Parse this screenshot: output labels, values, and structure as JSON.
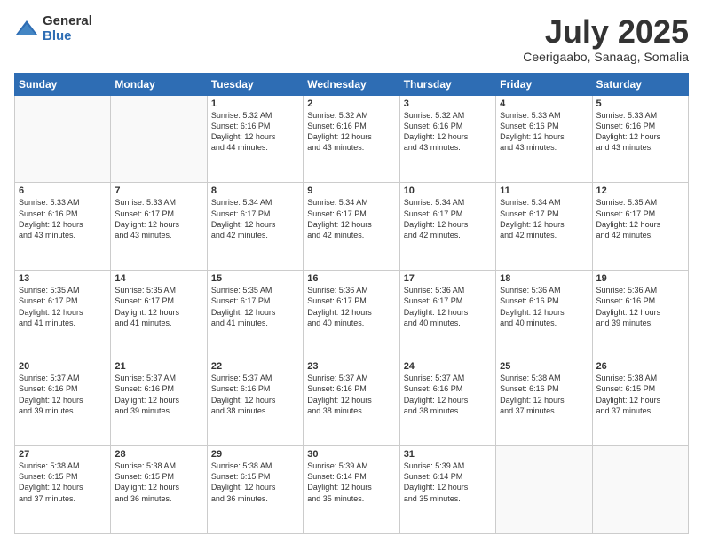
{
  "header": {
    "logo_general": "General",
    "logo_blue": "Blue",
    "month_title": "July 2025",
    "subtitle": "Ceerigaabo, Sanaag, Somalia"
  },
  "days_of_week": [
    "Sunday",
    "Monday",
    "Tuesday",
    "Wednesday",
    "Thursday",
    "Friday",
    "Saturday"
  ],
  "weeks": [
    [
      {
        "day": "",
        "info": ""
      },
      {
        "day": "",
        "info": ""
      },
      {
        "day": "1",
        "info": "Sunrise: 5:32 AM\nSunset: 6:16 PM\nDaylight: 12 hours\nand 44 minutes."
      },
      {
        "day": "2",
        "info": "Sunrise: 5:32 AM\nSunset: 6:16 PM\nDaylight: 12 hours\nand 43 minutes."
      },
      {
        "day": "3",
        "info": "Sunrise: 5:32 AM\nSunset: 6:16 PM\nDaylight: 12 hours\nand 43 minutes."
      },
      {
        "day": "4",
        "info": "Sunrise: 5:33 AM\nSunset: 6:16 PM\nDaylight: 12 hours\nand 43 minutes."
      },
      {
        "day": "5",
        "info": "Sunrise: 5:33 AM\nSunset: 6:16 PM\nDaylight: 12 hours\nand 43 minutes."
      }
    ],
    [
      {
        "day": "6",
        "info": "Sunrise: 5:33 AM\nSunset: 6:16 PM\nDaylight: 12 hours\nand 43 minutes."
      },
      {
        "day": "7",
        "info": "Sunrise: 5:33 AM\nSunset: 6:17 PM\nDaylight: 12 hours\nand 43 minutes."
      },
      {
        "day": "8",
        "info": "Sunrise: 5:34 AM\nSunset: 6:17 PM\nDaylight: 12 hours\nand 42 minutes."
      },
      {
        "day": "9",
        "info": "Sunrise: 5:34 AM\nSunset: 6:17 PM\nDaylight: 12 hours\nand 42 minutes."
      },
      {
        "day": "10",
        "info": "Sunrise: 5:34 AM\nSunset: 6:17 PM\nDaylight: 12 hours\nand 42 minutes."
      },
      {
        "day": "11",
        "info": "Sunrise: 5:34 AM\nSunset: 6:17 PM\nDaylight: 12 hours\nand 42 minutes."
      },
      {
        "day": "12",
        "info": "Sunrise: 5:35 AM\nSunset: 6:17 PM\nDaylight: 12 hours\nand 42 minutes."
      }
    ],
    [
      {
        "day": "13",
        "info": "Sunrise: 5:35 AM\nSunset: 6:17 PM\nDaylight: 12 hours\nand 41 minutes."
      },
      {
        "day": "14",
        "info": "Sunrise: 5:35 AM\nSunset: 6:17 PM\nDaylight: 12 hours\nand 41 minutes."
      },
      {
        "day": "15",
        "info": "Sunrise: 5:35 AM\nSunset: 6:17 PM\nDaylight: 12 hours\nand 41 minutes."
      },
      {
        "day": "16",
        "info": "Sunrise: 5:36 AM\nSunset: 6:17 PM\nDaylight: 12 hours\nand 40 minutes."
      },
      {
        "day": "17",
        "info": "Sunrise: 5:36 AM\nSunset: 6:17 PM\nDaylight: 12 hours\nand 40 minutes."
      },
      {
        "day": "18",
        "info": "Sunrise: 5:36 AM\nSunset: 6:16 PM\nDaylight: 12 hours\nand 40 minutes."
      },
      {
        "day": "19",
        "info": "Sunrise: 5:36 AM\nSunset: 6:16 PM\nDaylight: 12 hours\nand 39 minutes."
      }
    ],
    [
      {
        "day": "20",
        "info": "Sunrise: 5:37 AM\nSunset: 6:16 PM\nDaylight: 12 hours\nand 39 minutes."
      },
      {
        "day": "21",
        "info": "Sunrise: 5:37 AM\nSunset: 6:16 PM\nDaylight: 12 hours\nand 39 minutes."
      },
      {
        "day": "22",
        "info": "Sunrise: 5:37 AM\nSunset: 6:16 PM\nDaylight: 12 hours\nand 38 minutes."
      },
      {
        "day": "23",
        "info": "Sunrise: 5:37 AM\nSunset: 6:16 PM\nDaylight: 12 hours\nand 38 minutes."
      },
      {
        "day": "24",
        "info": "Sunrise: 5:37 AM\nSunset: 6:16 PM\nDaylight: 12 hours\nand 38 minutes."
      },
      {
        "day": "25",
        "info": "Sunrise: 5:38 AM\nSunset: 6:16 PM\nDaylight: 12 hours\nand 37 minutes."
      },
      {
        "day": "26",
        "info": "Sunrise: 5:38 AM\nSunset: 6:15 PM\nDaylight: 12 hours\nand 37 minutes."
      }
    ],
    [
      {
        "day": "27",
        "info": "Sunrise: 5:38 AM\nSunset: 6:15 PM\nDaylight: 12 hours\nand 37 minutes."
      },
      {
        "day": "28",
        "info": "Sunrise: 5:38 AM\nSunset: 6:15 PM\nDaylight: 12 hours\nand 36 minutes."
      },
      {
        "day": "29",
        "info": "Sunrise: 5:38 AM\nSunset: 6:15 PM\nDaylight: 12 hours\nand 36 minutes."
      },
      {
        "day": "30",
        "info": "Sunrise: 5:39 AM\nSunset: 6:14 PM\nDaylight: 12 hours\nand 35 minutes."
      },
      {
        "day": "31",
        "info": "Sunrise: 5:39 AM\nSunset: 6:14 PM\nDaylight: 12 hours\nand 35 minutes."
      },
      {
        "day": "",
        "info": ""
      },
      {
        "day": "",
        "info": ""
      }
    ]
  ]
}
